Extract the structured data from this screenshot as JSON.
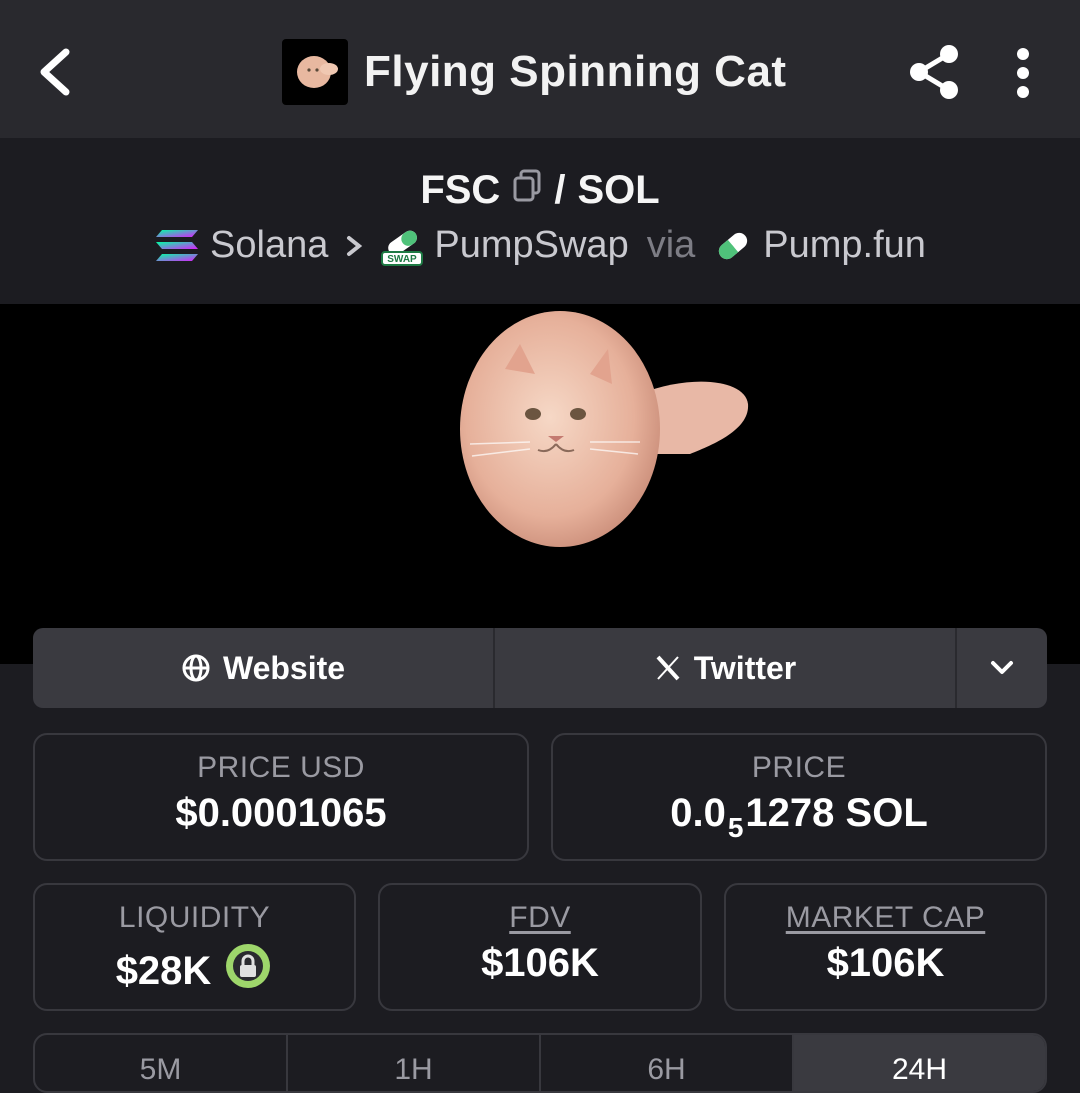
{
  "appbar": {
    "title": "Flying Spinning Cat"
  },
  "pair": {
    "base": "FSC",
    "separator": "/",
    "quote": "SOL",
    "chain": "Solana",
    "dex": "PumpSwap",
    "dex_badge": "SWAP",
    "via": "via",
    "launchpad": "Pump.fun"
  },
  "links": {
    "website": "Website",
    "twitter": "Twitter"
  },
  "stats": {
    "price_usd_label": "PRICE USD",
    "price_usd_value": "$0.0001065",
    "price_label": "PRICE",
    "price_prefix": "0.0",
    "price_zeros": "5",
    "price_digits": "1278 SOL",
    "liquidity_label": "LIQUIDITY",
    "liquidity_value": "$28K",
    "fdv_label": "FDV",
    "fdv_value": "$106K",
    "mcap_label": "MARKET CAP",
    "mcap_value": "$106K"
  },
  "colors": {
    "appbar": "#29292e",
    "background": "#1c1c21",
    "lock_green": "#9ed66b"
  },
  "tabs": [
    "5M",
    "1H",
    "6H",
    "24H"
  ]
}
